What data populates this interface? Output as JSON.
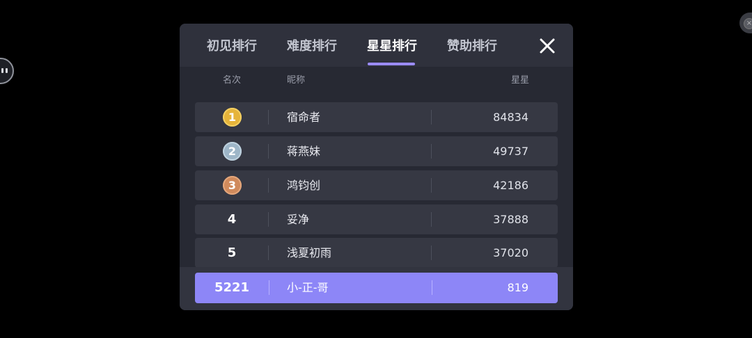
{
  "tabs": [
    {
      "label": "初见排行",
      "active": false
    },
    {
      "label": "难度排行",
      "active": false
    },
    {
      "label": "星星排行",
      "active": true
    },
    {
      "label": "赞助排行",
      "active": false
    }
  ],
  "close_icon": "close-x-icon",
  "columns": {
    "rank": "名次",
    "name": "昵称",
    "stars": "星星"
  },
  "rows": [
    {
      "rank": "1",
      "medal": "gold",
      "name": "宿命者",
      "stars": "84834"
    },
    {
      "rank": "2",
      "medal": "silver",
      "name": "蒋燕妹",
      "stars": "49737"
    },
    {
      "rank": "3",
      "medal": "bronze",
      "name": "鸿钧创",
      "stars": "42186"
    },
    {
      "rank": "4",
      "name": "妥净",
      "stars": "37888"
    },
    {
      "rank": "5",
      "name": "浅夏初雨",
      "stars": "37020"
    }
  ],
  "my_row": {
    "rank": "5221",
    "name": "小-正-哥",
    "stars": "819"
  },
  "colors": {
    "accent": "#9b8cff",
    "my_row_bg": "#8d86f7",
    "gold": "#e6b43a",
    "silver": "#9eb6c8",
    "bronze": "#d08a5c"
  }
}
